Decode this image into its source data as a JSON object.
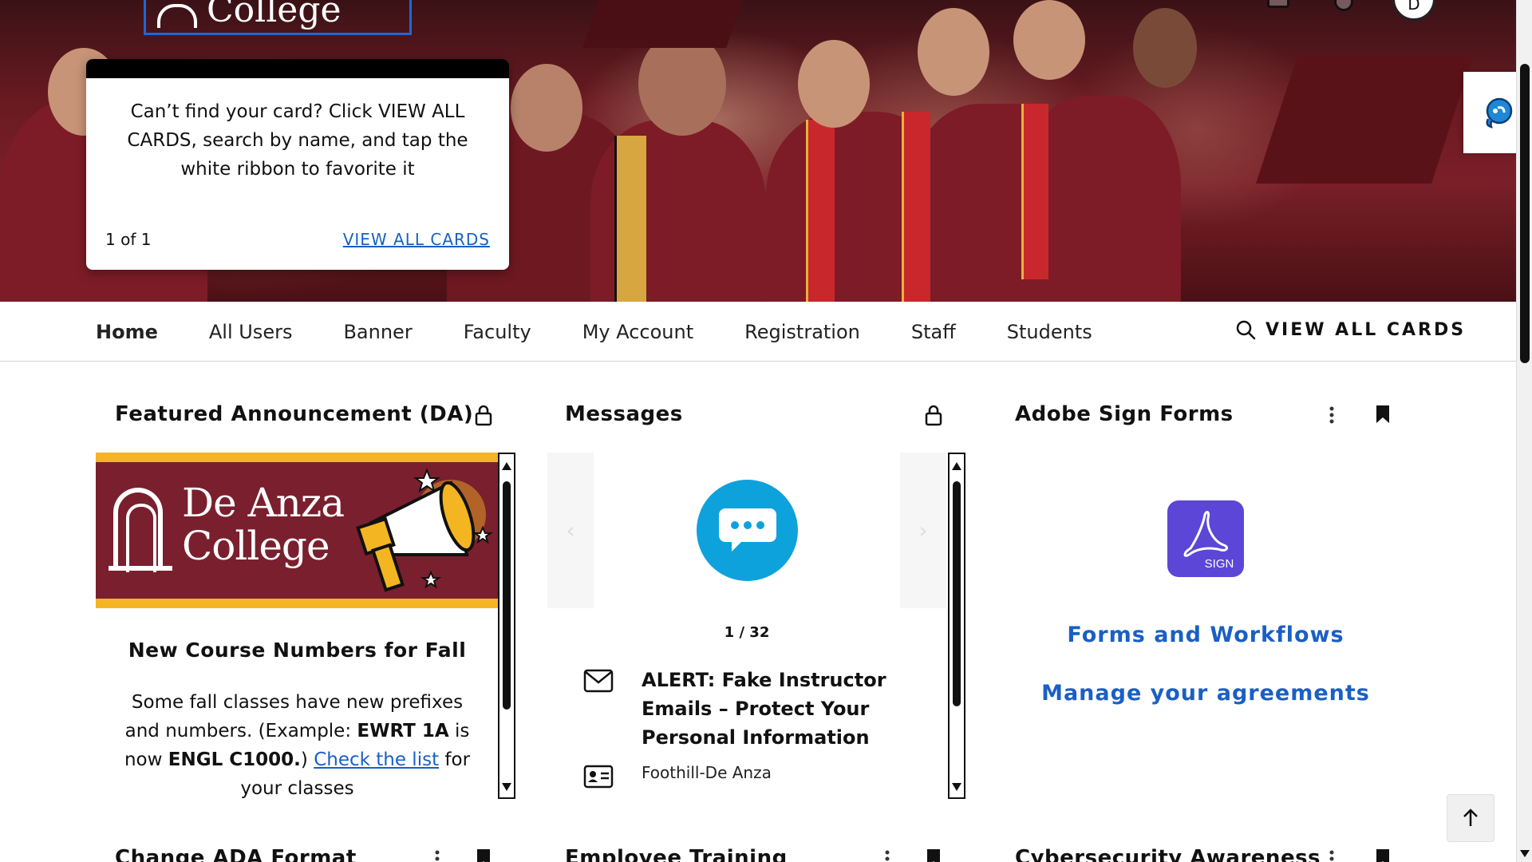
{
  "header": {
    "logo_text": "College",
    "notice": {
      "message": "Can’t find your card? Click VIEW ALL CARDS, search by name, and tap the white ribbon to favorite it",
      "pager": "1 of 1",
      "link": "VIEW ALL CARDS"
    }
  },
  "nav": {
    "tabs": [
      {
        "label": "Home",
        "active": true
      },
      {
        "label": "All Users"
      },
      {
        "label": "Banner"
      },
      {
        "label": "Faculty"
      },
      {
        "label": "My Account"
      },
      {
        "label": "Registration"
      },
      {
        "label": "Staff"
      },
      {
        "label": "Students"
      }
    ],
    "view_all": "VIEW ALL CARDS"
  },
  "avatar_initial": "D",
  "cards": {
    "featured": {
      "title": "Featured Announcement (DA)",
      "banner_name_line1": "De Anza",
      "banner_name_line2": "College",
      "headline": "New Course Numbers for Fall",
      "body_1": "Some fall classes have new prefixes and numbers. (Example: ",
      "body_code_old": "EWRT 1A",
      "body_2": " is now ",
      "body_code_new": "ENGL C1000.",
      "body_3": ")",
      "link": "Check the list",
      "body_4": " for your classes"
    },
    "messages": {
      "title": "Messages",
      "counter": "1 / 32",
      "alert_title": "ALERT: Fake Instructor Emails – Protect Your Personal Information",
      "source": "Foothill-De Anza"
    },
    "adobe": {
      "title": "Adobe Sign Forms",
      "tile_label": "SIGN",
      "link1": "Forms and Workflows",
      "link2": "Manage your agreements"
    },
    "row2": [
      {
        "title": "Change ADA Format"
      },
      {
        "title": "Employee Training"
      },
      {
        "title": "Cybersecurity Awareness"
      }
    ]
  },
  "colors": {
    "maroon": "#7a1f2e",
    "gold": "#f3b521",
    "link_blue": "#1a5fc4",
    "message_blue": "#0ea2dd",
    "adobe_purple": "#5b46d8"
  }
}
